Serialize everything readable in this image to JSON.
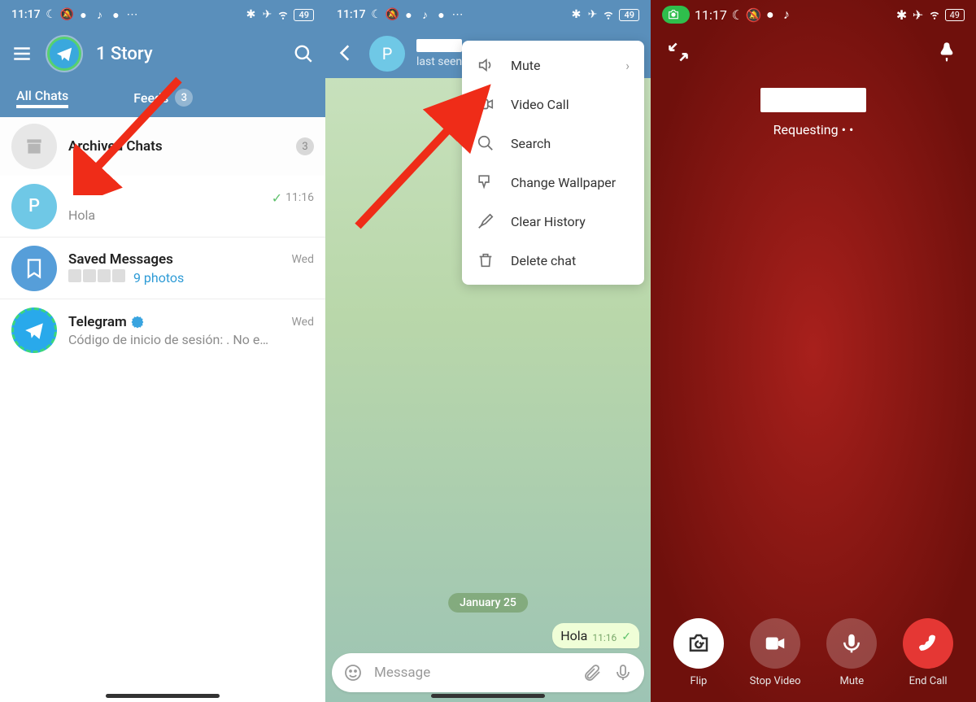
{
  "status": {
    "time": "11:17",
    "battery": "49"
  },
  "screen1": {
    "title": "1 Story",
    "tabs": {
      "all": "All Chats",
      "feeds": "Feeds",
      "feeds_count": "3"
    },
    "archived": {
      "title": "Archived Chats",
      "count": "3"
    },
    "chat_p": {
      "letter": "P",
      "message": "Hola",
      "time": "11:16"
    },
    "chat_saved": {
      "name": "Saved Messages",
      "photos_label": "9 photos",
      "time": "Wed"
    },
    "chat_tg": {
      "name": "Telegram",
      "preview": "Código de inicio de sesión:            . No e…",
      "time": "Wed"
    }
  },
  "screen2": {
    "avatar_letter": "P",
    "status_line": "last seen",
    "menu": {
      "mute": "Mute",
      "video": "Video Call",
      "search": "Search",
      "wallpaper": "Change Wallpaper",
      "clear": "Clear History",
      "delete": "Delete chat"
    },
    "date_chip": "January 25",
    "message": {
      "text": "Hola",
      "time": "11:16"
    },
    "input_placeholder": "Message"
  },
  "screen3": {
    "requesting": "Requesting • •",
    "controls": {
      "flip": "Flip",
      "stop_video": "Stop Video",
      "mute": "Mute",
      "end": "End Call"
    }
  }
}
